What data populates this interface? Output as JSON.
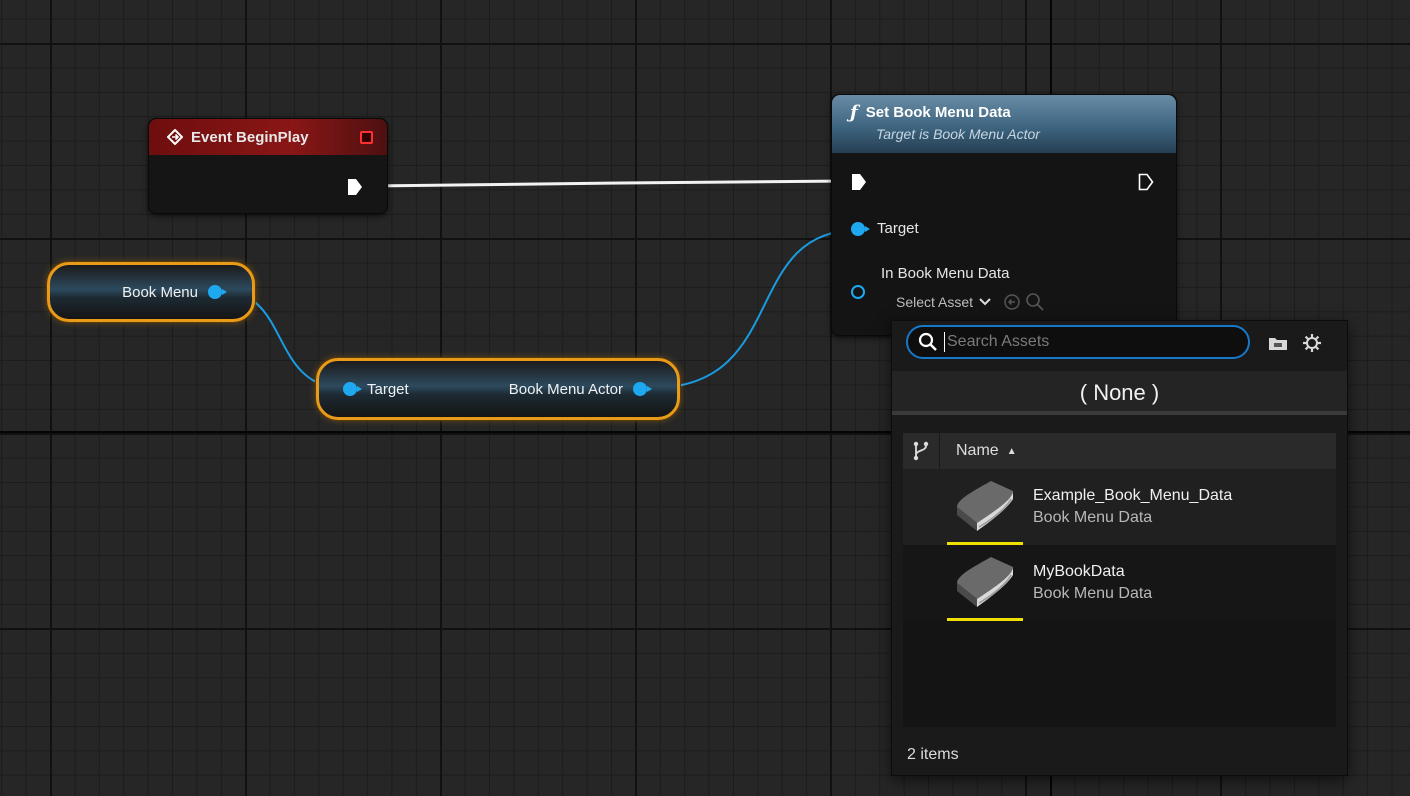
{
  "graph": {
    "event_node": {
      "title": "Event BeginPlay"
    },
    "function_node": {
      "title": "Set Book Menu Data",
      "subtitle": "Target is Book Menu Actor",
      "target_label": "Target",
      "data_label": "In Book Menu Data",
      "select_asset_label": "Select Asset"
    },
    "variable_node": {
      "label": "Book Menu"
    },
    "getter_node": {
      "input_label": "Target",
      "output_label": "Book Menu Actor"
    }
  },
  "asset_picker": {
    "search_placeholder": "Search Assets",
    "search_value": "",
    "none_label": "( None )",
    "column_name": "Name",
    "assets": [
      {
        "name": "Example_Book_Menu_Data",
        "type": "Book Menu Data"
      },
      {
        "name": "MyBookData",
        "type": "Book Menu Data"
      }
    ],
    "item_count": "2 items"
  },
  "colors": {
    "event_header": "#8a1616",
    "function_header": "#3e6580",
    "object_pin": "#1ea8f0",
    "selected_outline": "#e89a1a",
    "search_focus": "#1778c9",
    "asset_underline": "#f0e000"
  },
  "icons": {
    "event": "event-diamond-icon",
    "function": "function-icon",
    "search": "search-icon",
    "folder": "folder-icon",
    "settings": "gear-icon",
    "book": "book-icon"
  }
}
